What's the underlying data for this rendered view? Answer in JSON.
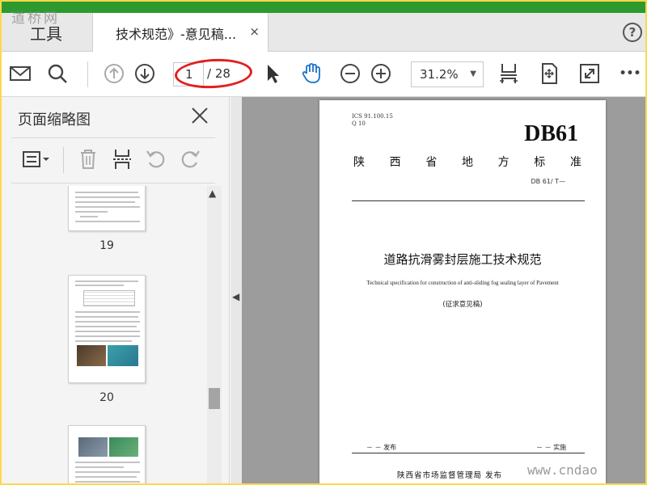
{
  "watermark": {
    "top": "道桥网",
    "bottom_right": "www.cndao"
  },
  "tabs": {
    "tools": "工具",
    "document": "技术规范》-意见稿...",
    "close_symbol": "×"
  },
  "help_symbol": "?",
  "toolbar": {
    "page_current": "1",
    "page_total": "/ 28",
    "zoom": "31.2%",
    "more": "•••"
  },
  "sidebar": {
    "title": "页面缩略图",
    "thumbnails": [
      {
        "number": "19"
      },
      {
        "number": "20"
      },
      {
        "number": ""
      }
    ]
  },
  "document": {
    "ics_line1": "ICS 91.100.15",
    "ics_line2": "Q 10",
    "standard_code": "DB61",
    "province_chars": [
      "陕",
      "西",
      "省",
      "地",
      "方",
      "标",
      "准"
    ],
    "standard_number": "DB 61/  T—",
    "title_cn": "道路抗滑雾封层施工技术规范",
    "title_en": "Technical specification for  construction of anti-sliding fog sealing layer of Pavement",
    "draft_note": "(征求意见稿)",
    "publish_left": "－ －  发布",
    "publish_right": "－ －    实施",
    "issuer": "陕西省市场监督管理局  发布"
  }
}
